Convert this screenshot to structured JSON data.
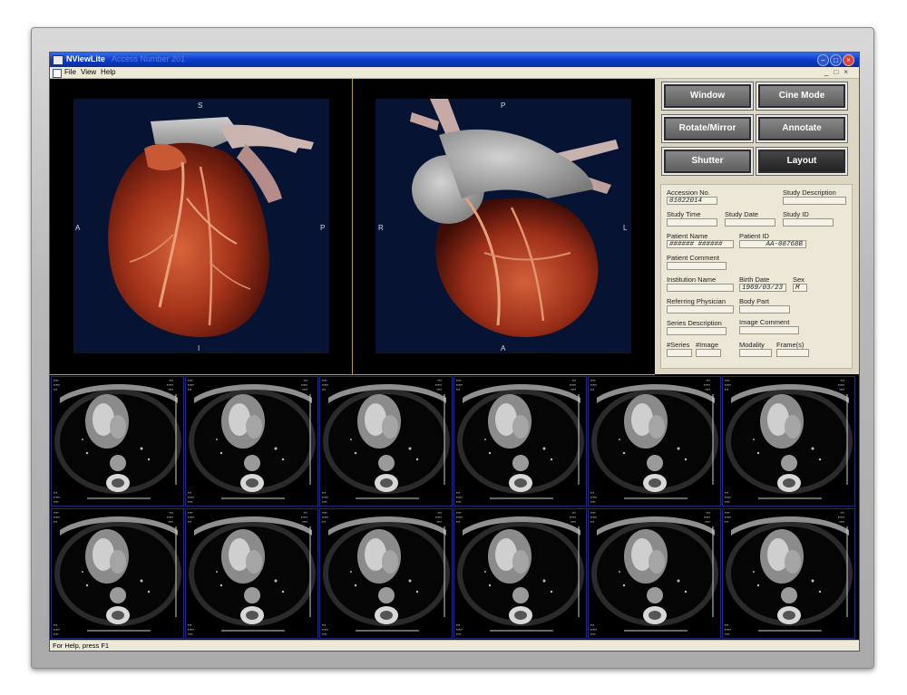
{
  "window": {
    "title": "NViewLite",
    "subtitle": "Access Number 201",
    "buttons": {
      "minimize": "–",
      "maximize": "□",
      "close": "×"
    }
  },
  "menu": {
    "items": [
      "File",
      "View",
      "Help"
    ],
    "mdi": [
      "_",
      "□",
      "×"
    ]
  },
  "views": {
    "left": {
      "top": "S",
      "bottom": "I",
      "left": "A",
      "right": "P"
    },
    "right": {
      "top": "P",
      "bottom": "A",
      "left": "R",
      "right": "L"
    }
  },
  "panel": {
    "buttons": {
      "window": "Window",
      "cine_mode": "Cine Mode",
      "rotate_mirror": "Rotate/Mirror",
      "annotate": "Annotate",
      "shutter": "Shutter",
      "layout": "Layout"
    },
    "fields": {
      "accession_no": {
        "label": "Accession No.",
        "value": "01022014"
      },
      "study_description": {
        "label": "Study Description",
        "value": ""
      },
      "study_time": {
        "label": "Study Time",
        "value": ""
      },
      "study_date": {
        "label": "Study Date",
        "value": ""
      },
      "study_id": {
        "label": "Study ID",
        "value": ""
      },
      "patient_name": {
        "label": "Patient Name",
        "value": "###### ######"
      },
      "patient_id": {
        "label": "Patient ID",
        "value": "AA-08768B"
      },
      "patient_comment": {
        "label": "Patient Comment",
        "value": ""
      },
      "institution_name": {
        "label": "Institution Name",
        "value": ""
      },
      "birth_date": {
        "label": "Birth Date",
        "value": "1969/03/23"
      },
      "sex": {
        "label": "Sex",
        "value": "M"
      },
      "referring_physician": {
        "label": "Referring Physician",
        "value": ""
      },
      "body_part": {
        "label": "Body Part",
        "value": ""
      },
      "series_description": {
        "label": "Series Description",
        "value": ""
      },
      "image_comment": {
        "label": "Image Comment",
        "value": ""
      },
      "series_count": {
        "label": "#Series",
        "value": ""
      },
      "image_count": {
        "label": "#Image",
        "value": ""
      },
      "modality": {
        "label": "Modality",
        "value": ""
      },
      "frames": {
        "label": "Frame(s)",
        "value": ""
      }
    }
  },
  "status": {
    "text": "For Help, press F1"
  }
}
